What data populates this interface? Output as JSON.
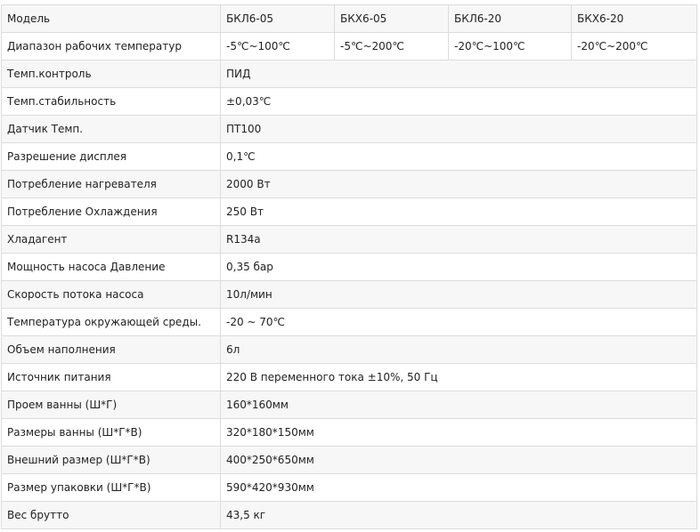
{
  "table": {
    "header": {
      "label": "Модель",
      "models": [
        "БКЛ6-05",
        "БКХ6-05",
        "БКЛ6-20",
        "БКХ6-20"
      ]
    },
    "temp_range": {
      "label": "Диапазон рабочих температур",
      "values": [
        "-5℃~100℃",
        "-5℃~200℃",
        "-20℃~100℃",
        "-20℃~200℃"
      ]
    },
    "rows": [
      {
        "label": "Темп.контроль",
        "value": "ПИД"
      },
      {
        "label": "Темп.стабильность",
        "value": "±0,03℃"
      },
      {
        "label": "Датчик Темп.",
        "value": "ПТ100"
      },
      {
        "label": "Разрешение дисплея",
        "value": "0,1℃"
      },
      {
        "label": "Потребление нагревателя",
        "value": "2000 Вт"
      },
      {
        "label": "Потребление Охлаждения",
        "value": "250 Вт"
      },
      {
        "label": "Хладагент",
        "value": "R134a"
      },
      {
        "label": "Мощность насоса Давление",
        "value": "0,35 бар"
      },
      {
        "label": "Скорость потока насоса",
        "value": "10л/мин"
      },
      {
        "label": "Температура окружающей среды.",
        "value": "-20 ~ 70℃"
      },
      {
        "label": "Объем наполнения",
        "value": "6л"
      },
      {
        "label": "Источник питания",
        "value": "220 В переменного тока ±10%, 50 Гц"
      },
      {
        "label": "Проем ванны (Ш*Г)",
        "value": "160*160мм"
      },
      {
        "label": "Размеры ванны (Ш*Г*В)",
        "value": "320*180*150мм"
      },
      {
        "label": "Внешний размер (Ш*Г*В)",
        "value": "400*250*650мм"
      },
      {
        "label": "Размер упаковки (Ш*Г*В)",
        "value": "590*420*930мм"
      },
      {
        "label": "Вес брутто",
        "value": "43,5 кг"
      }
    ]
  }
}
